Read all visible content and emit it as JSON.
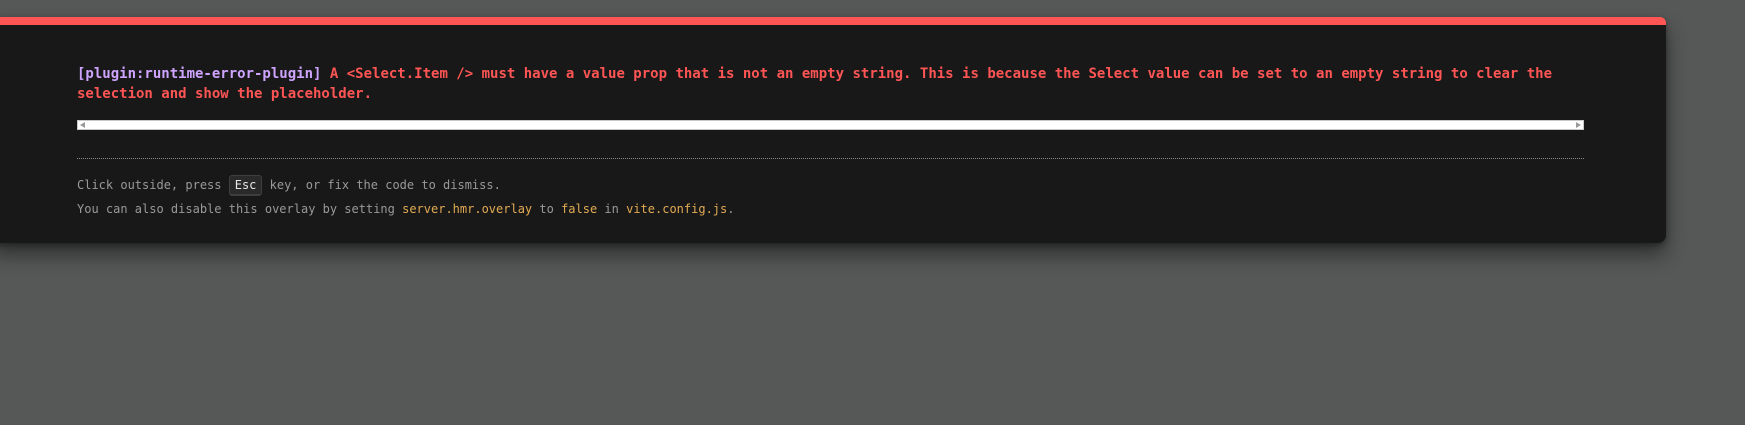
{
  "colors": {
    "accent": "#ff5555",
    "plugin": "#cfa4ff",
    "code": "#e2aa53",
    "panel_background": "#181818",
    "backdrop": "#555857"
  },
  "error": {
    "plugin": "[plugin:runtime-error-plugin]",
    "message": "A <Select.Item /> must have a value prop that is not an empty string. This is because the Select value can be set to an empty string to clear the selection and show the placeholder."
  },
  "tip": {
    "line1_before": "Click outside, press ",
    "key": "Esc",
    "line1_after": " key, or fix the code to dismiss.",
    "line2_before": "You can also disable this overlay by setting ",
    "setting": "server.hmr.overlay",
    "line2_mid1": " to ",
    "value": "false",
    "line2_mid2": " in ",
    "config_file": "vite.config.js",
    "line2_end": "."
  }
}
